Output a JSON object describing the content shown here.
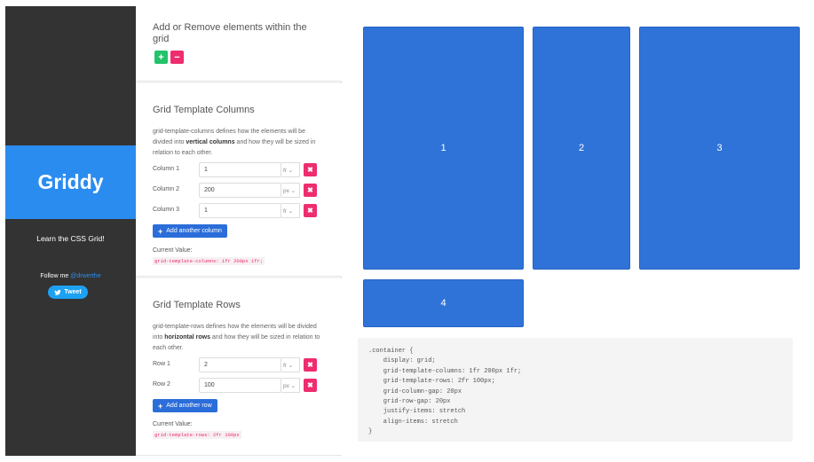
{
  "sidebar": {
    "brand": "Griddy",
    "tagline": "Learn the CSS Grid!",
    "follow_text": "Follow me ",
    "follow_handle": "@drwerthe",
    "tweet_label": "Tweet"
  },
  "elements_card": {
    "title": "Add or Remove elements within the grid",
    "add_icon": "+",
    "remove_icon": "−"
  },
  "columns_card": {
    "title": "Grid Template Columns",
    "desc_pre": "grid-template-columns defines how the elements will be divided into ",
    "desc_bold": "vertical columns",
    "desc_post": " and how they will be sized in relation to each other.",
    "rows": [
      {
        "label": "Column 1",
        "value": "1",
        "unit": "fr"
      },
      {
        "label": "Column 2",
        "value": "200",
        "unit": "px"
      },
      {
        "label": "Column 3",
        "value": "1",
        "unit": "fr"
      }
    ],
    "add_label": "Add another column",
    "current_label": "Current Value:",
    "current_value": "grid-template-columns: 1fr 200px 1fr;"
  },
  "rows_card": {
    "title": "Grid Template Rows",
    "desc_pre": "grid-template-rows defines how the elements will be divided into ",
    "desc_bold": "horizontal rows",
    "desc_post": " and how they will be sized in relation to each other.",
    "rows": [
      {
        "label": "Row 1",
        "value": "2",
        "unit": "fr"
      },
      {
        "label": "Row 2",
        "value": "100",
        "unit": "px"
      }
    ],
    "add_label": "Add another row",
    "current_label": "Current Value:",
    "current_value": "grid-template-rows: 2fr 100px"
  },
  "preview": {
    "cells": [
      "1",
      "2",
      "3",
      "4"
    ],
    "code": ".container {\n    display: grid;\n    grid-template-columns: 1fr 200px 1fr;\n    grid-template-rows: 2fr 100px;\n    grid-column-gap: 20px\n    grid-row-gap: 20px\n    justify-items: stretch\n    align-items: stretch\n}"
  },
  "colors": {
    "sidebar_bg": "#333333",
    "brand_bg": "#2b8cef",
    "cell_bg": "#2f73d8",
    "add_green": "#23c36a",
    "remove_pink": "#ee2d6e",
    "button_blue": "#2b6dd9"
  },
  "icons": {
    "plus": "plus-icon",
    "minus": "minus-icon",
    "delete": "close-icon",
    "chevron": "chevron-down-icon",
    "twitter": "twitter-bird-icon"
  }
}
